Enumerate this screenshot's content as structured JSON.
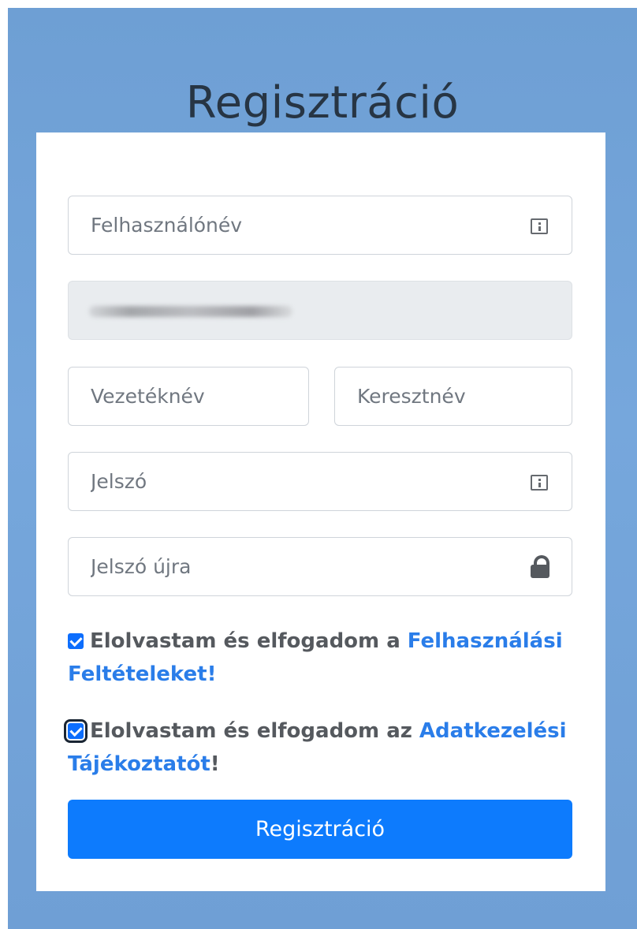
{
  "page": {
    "title": "Regisztráció"
  },
  "form": {
    "username": {
      "placeholder": "Felhasználónév",
      "icon": "info-icon"
    },
    "email": {
      "value": "",
      "disabled": true
    },
    "last_name": {
      "placeholder": "Vezetéknév"
    },
    "first_name": {
      "placeholder": "Keresztnév"
    },
    "password": {
      "placeholder": "Jelszó",
      "icon": "info-icon"
    },
    "password_again": {
      "placeholder": "Jelszó újra",
      "icon": "lock-icon"
    },
    "terms": {
      "checked": true,
      "text": "Elolvastam és elfogadom a ",
      "link": "Felhasználási Feltételeket!",
      "suffix": ""
    },
    "privacy": {
      "checked": true,
      "text": "Elolvastam és elfogadom az ",
      "link": "Adatkezelési Tájékoztatót",
      "suffix": "!"
    },
    "submit_label": "Regisztráció"
  },
  "colors": {
    "background": "#6e9fd4",
    "primary": "#0d7bfd",
    "link": "#2a7de9",
    "title": "#273544"
  }
}
